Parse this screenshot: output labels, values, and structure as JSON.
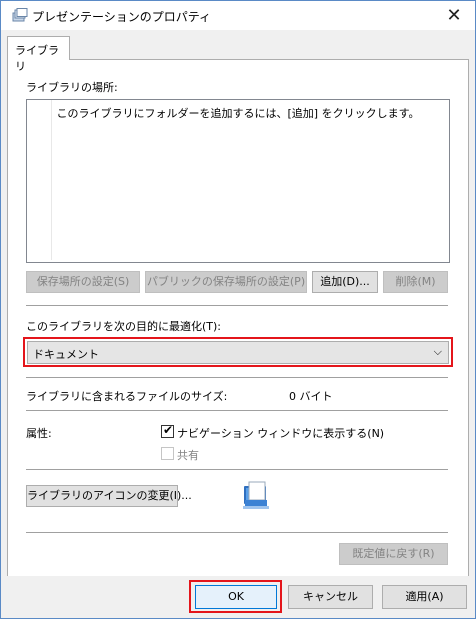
{
  "window": {
    "title": "プレゼンテーションのプロパティ",
    "close_glyph": "✕"
  },
  "tab": {
    "label": "ライブラリ"
  },
  "library_locations": {
    "label": "ライブラリの場所:",
    "empty_message": "このライブラリにフォルダーを追加するには、[追加] をクリックします。"
  },
  "location_buttons": {
    "set_save": "保存場所の設定(S)",
    "set_public_save": "パブリックの保存場所の設定(P)",
    "add": "追加(D)...",
    "remove": "削除(M)"
  },
  "optimize": {
    "label": "このライブラリを次の目的に最適化(T):",
    "selected": "ドキュメント",
    "arrow": "⌵"
  },
  "size": {
    "label": "ライブラリに含まれるファイルのサイズ:",
    "value": "0 バイト"
  },
  "attributes": {
    "label": "属性:",
    "show_in_nav": {
      "label": "ナビゲーション ウィンドウに表示する(N)",
      "checked": true
    },
    "shared": {
      "label": "共有",
      "checked": false,
      "enabled": false
    }
  },
  "change_icon_button": "ライブラリのアイコンの変更(I)...",
  "restore_defaults_button": "既定値に戻す(R)",
  "footer": {
    "ok": "OK",
    "cancel": "キャンセル",
    "apply": "適用(A)"
  },
  "colors": {
    "highlight": "#e4151b",
    "window_border": "#5a8ac6",
    "disabled_text": "#838383"
  }
}
